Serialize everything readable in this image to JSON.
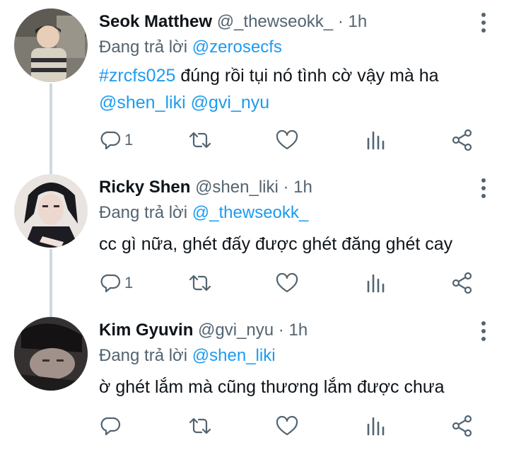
{
  "tweets": [
    {
      "name": "Seok Matthew",
      "handle": "@_thewseokk_",
      "sep": "·",
      "time": "1h",
      "reply_prefix": "Đang trả lời",
      "reply_to": "@zerosecfs",
      "hashtag": "#zrcfs025",
      "text": "đúng rồi tụi nó tình cờ vậy mà ha",
      "mention1": "@shen_liki",
      "mention2": "@gvi_nyu",
      "reply_count": "1",
      "avatar_colors": [
        "#6b6a64",
        "#b9b3a6"
      ]
    },
    {
      "name": "Ricky Shen",
      "handle": "@shen_liki",
      "sep": "·",
      "time": "1h",
      "reply_prefix": "Đang trả lời",
      "reply_to": "@_thewseokk_",
      "text": "cc gì nữa, ghét đấy được ghét đăng ghét cay",
      "reply_count": "1",
      "avatar_colors": [
        "#1b1b1f",
        "#d9cfc9"
      ]
    },
    {
      "name": "Kim Gyuvin",
      "handle": "@gvi_nyu",
      "sep": "·",
      "time": "1h",
      "reply_prefix": "Đang trả lời",
      "reply_to": "@shen_liki",
      "text": "ờ ghét lắm mà cũng thương lắm được chưa",
      "reply_count": "",
      "avatar_colors": [
        "#2a2828",
        "#8c7f79"
      ]
    }
  ],
  "colors": {
    "link": "#1d9bf0",
    "secondary": "#536471",
    "thread_line": "#cfd9de",
    "icon": "#536471"
  },
  "icons": [
    "reply-icon",
    "retweet-icon",
    "like-icon",
    "views-icon",
    "share-icon",
    "more-icon"
  ]
}
